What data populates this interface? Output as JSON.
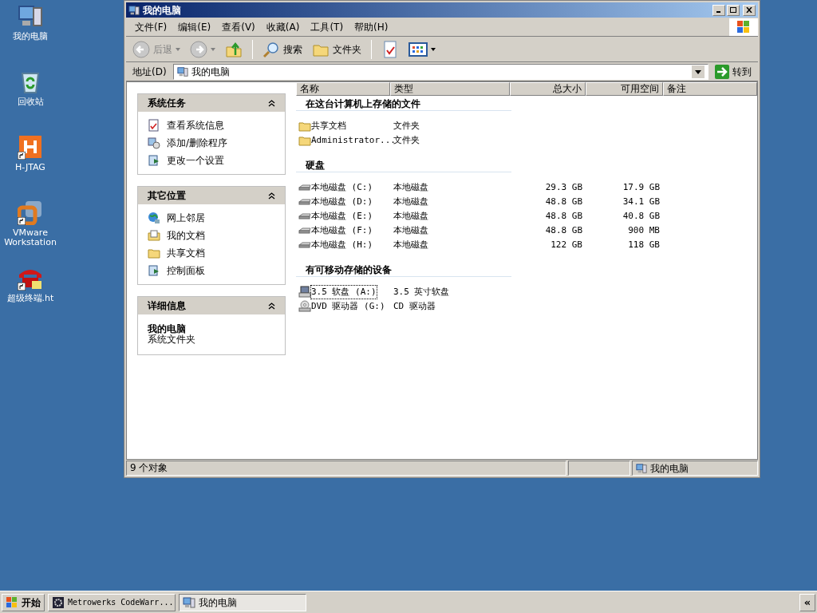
{
  "desktop_icons": [
    {
      "label": "我的电脑",
      "kind": "computer",
      "shortcut": false
    },
    {
      "label": "回收站",
      "kind": "recycle",
      "shortcut": false
    },
    {
      "label": "H-JTAG",
      "kind": "hjtag",
      "shortcut": true
    },
    {
      "label": "VMware Workstation",
      "kind": "vmware",
      "shortcut": true
    },
    {
      "label": "超级终端.ht",
      "kind": "phone",
      "shortcut": true
    }
  ],
  "window": {
    "title": "我的电脑",
    "menu": [
      "文件(F)",
      "编辑(E)",
      "查看(V)",
      "收藏(A)",
      "工具(T)",
      "帮助(H)"
    ],
    "toolbar": {
      "back": {
        "label": "后退",
        "disabled": true
      },
      "forward": {
        "disabled": true
      },
      "search": "搜索",
      "folders": "文件夹"
    },
    "address": {
      "label": "地址(D)",
      "value": "我的电脑",
      "go": "转到"
    },
    "task_panels": [
      {
        "title": "系统任务",
        "expanded": true,
        "items": [
          {
            "label": "查看系统信息",
            "kind": "info"
          },
          {
            "label": "添加/删除程序",
            "kind": "programs"
          },
          {
            "label": "更改一个设置",
            "kind": "settings"
          }
        ]
      },
      {
        "title": "其它位置",
        "expanded": true,
        "items": [
          {
            "label": "网上邻居",
            "kind": "network"
          },
          {
            "label": "我的文档",
            "kind": "documents"
          },
          {
            "label": "共享文档",
            "kind": "folder"
          },
          {
            "label": "控制面板",
            "kind": "settings"
          }
        ]
      },
      {
        "title": "详细信息",
        "expanded": true,
        "details": {
          "name": "我的电脑",
          "description": "系统文件夹"
        }
      }
    ],
    "columns": [
      "名称",
      "类型",
      "总大小",
      "可用空间",
      "备注"
    ],
    "groups": [
      {
        "title": "在这台计算机上存储的文件",
        "items": [
          {
            "name": "共享文档",
            "type": "文件夹",
            "kind": "folder",
            "selected": false
          },
          {
            "name": "Administrator...",
            "type": "文件夹",
            "kind": "folder",
            "selected": false
          }
        ]
      },
      {
        "title": "硬盘",
        "items": [
          {
            "name": "本地磁盘 (C:)",
            "type": "本地磁盘",
            "total": "29.3 GB",
            "free": "17.9 GB",
            "kind": "disk",
            "selected": false
          },
          {
            "name": "本地磁盘 (D:)",
            "type": "本地磁盘",
            "total": "48.8 GB",
            "free": "34.1 GB",
            "kind": "disk",
            "selected": false
          },
          {
            "name": "本地磁盘 (E:)",
            "type": "本地磁盘",
            "total": "48.8 GB",
            "free": "40.8 GB",
            "kind": "disk",
            "selected": false
          },
          {
            "name": "本地磁盘 (F:)",
            "type": "本地磁盘",
            "total": "48.8 GB",
            "free": "900 MB",
            "kind": "disk",
            "selected": false
          },
          {
            "name": "本地磁盘 (H:)",
            "type": "本地磁盘",
            "total": "122 GB",
            "free": "118 GB",
            "kind": "disk",
            "selected": false
          }
        ]
      },
      {
        "title": "有可移动存储的设备",
        "items": [
          {
            "name": "3.5 软盘 (A:)",
            "type": "3.5 英寸软盘",
            "kind": "floppy",
            "selected": true
          },
          {
            "name": "DVD 驱动器 (G:)",
            "type": "CD 驱动器",
            "kind": "dvd",
            "selected": false
          }
        ]
      }
    ],
    "status_bar": {
      "text": "9 个对象",
      "location": "我的电脑"
    }
  },
  "taskbar": {
    "start": "开始",
    "tasks": [
      {
        "label": "Metrowerks CodeWarr...",
        "kind": "codewarrior",
        "selected": false
      },
      {
        "label": "我的电脑",
        "kind": "computer",
        "selected": true
      }
    ],
    "tray_toggle": "«"
  }
}
